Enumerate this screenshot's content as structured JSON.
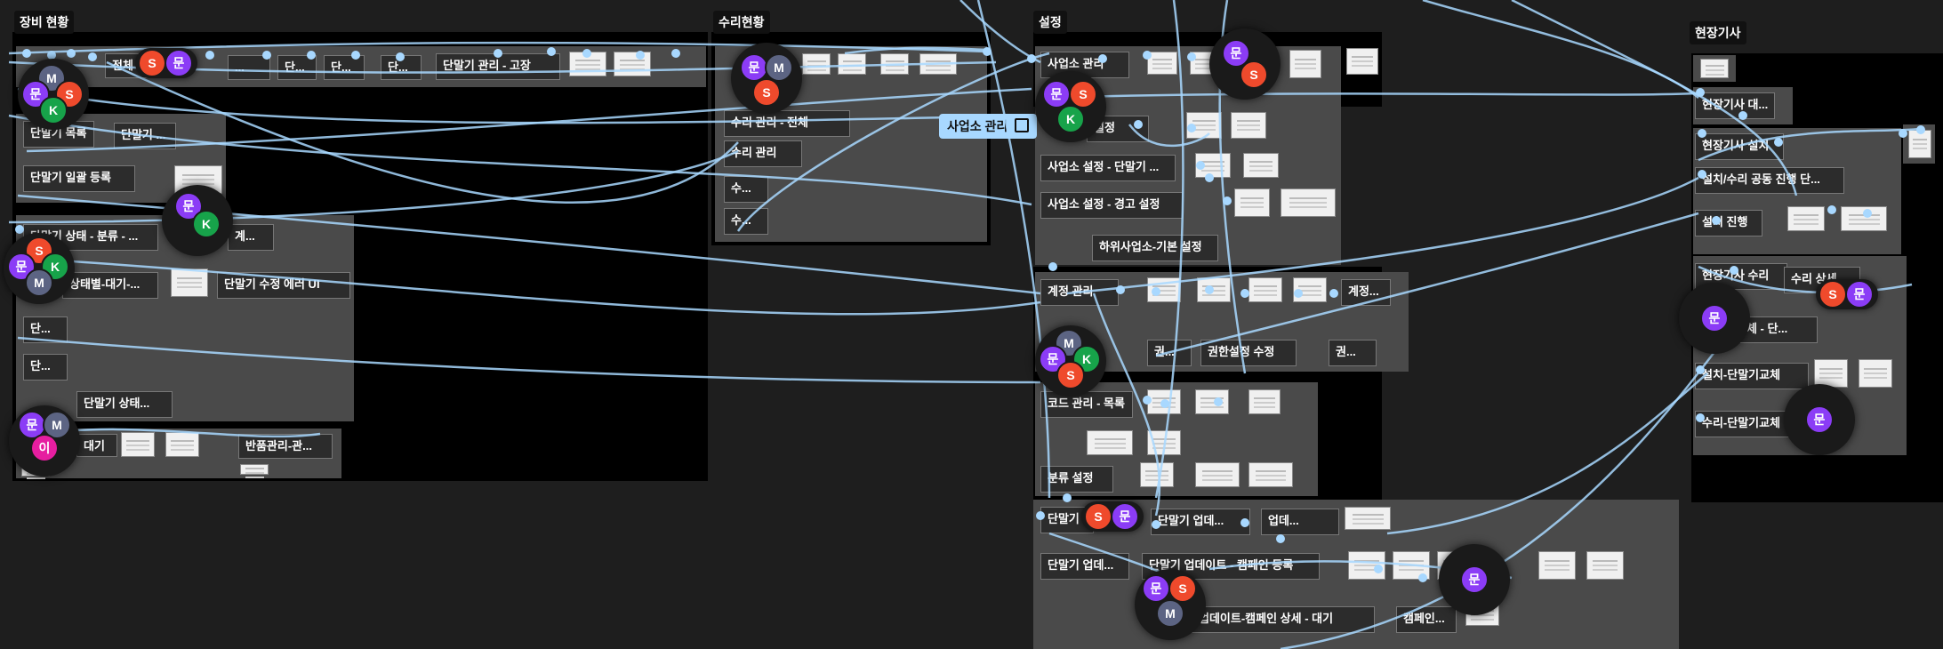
{
  "colors": {
    "canvas_bg": "#1e1e1e",
    "section_bg": "#000000",
    "connector": "#a8d8ff",
    "avatar_orange": "#ef4a2c",
    "avatar_purple": "#8b3cf6",
    "avatar_slate": "#5c6483",
    "avatar_green": "#17a34a",
    "avatar_pink": "#e61ea0"
  },
  "sections": {
    "equipment": {
      "title": "장비 현황"
    },
    "repair": {
      "title": "수리현황"
    },
    "settings": {
      "title": "설정"
    },
    "field": {
      "title": "현장기사"
    }
  },
  "frames": {
    "eq_top_1": "전체",
    "eq_top_2": "...",
    "eq_top_3": "단...",
    "eq_top_4": "단...",
    "eq_top_5": "단...",
    "eq_top_mgmt": "단말기 관리 - 고장",
    "eq_list": "단말기 목록",
    "eq_term": "단말기 ...",
    "eq_bulk": "단말기 일괄 등록",
    "eq_dist": "단말기 상태 - 분류 - ...",
    "eq_ing": "계...",
    "eq_status_wait": "상태별-대기-...",
    "eq_edit_err": "단말기 수정 에러 UI",
    "eq_small_1": "단...",
    "eq_small_2": "단...",
    "eq_status_2": "단말기 상태...",
    "eq_wait": "대기",
    "eq_return": "반품관리-관...",
    "rp_all": "수리 관리 - 전체",
    "rp_mgmt": "수리 관리",
    "rp_s1": "수...",
    "rp_s2": "수...",
    "st_biz": "사업소 관리",
    "st_set": "설정",
    "st_biz_term": "사업소 설정 - 단말기 ...",
    "st_biz_warn": "사업소 설정 - 경고 설정",
    "st_sub_biz": "하위사업소-기본 설정",
    "st_acct": "계정 관리",
    "st_acct2": "계정...",
    "st_perm": "권...",
    "st_perm_edit": "권한설정 수정",
    "st_perm2": "권...",
    "st_code": "코드 관리 - 목록",
    "st_class": "분류 설정",
    "st_term_upd": "단말기",
    "st_upd_a": "단말기 업데...",
    "st_upd_b": "업데...",
    "st_term_upd2": "단말기 업데...",
    "st_campaign_reg": "단말기 업데이트 - 캠페인 등록",
    "st_campaign_wait": "업데이트-캠페인 상세 - 대기",
    "st_campaign": "캠페인...",
    "fd_tech": "현장기사 대...",
    "fd_install": "현장기사 설치",
    "fd_progress": "설치/수리 공동 진행 단...",
    "fd_install_ing": "설치 진행",
    "fd_repair": "현장기사 수리",
    "fd_repair_stat": "수리 상세",
    "fd_replace_a": "교체 - 단...",
    "fd_replace_b": "설치-단말기교체",
    "fd_replace_c": "수리-단말기교체"
  },
  "chips": {
    "biz_mgmt": "사업소 관리"
  },
  "cursors": {
    "eq_top_pill": [
      "S",
      "문"
    ],
    "eq_cluster_1": [
      "M",
      "문",
      "S",
      "K"
    ],
    "eq_cluster_2": [
      "문",
      "K"
    ],
    "eq_cluster_3": [
      "S",
      "문",
      "K",
      "M"
    ],
    "eq_cluster_4": [
      "문",
      "M",
      "이"
    ],
    "repair_cluster": [
      "문",
      "M",
      "S"
    ],
    "settings_cluster_1": [
      "문",
      "S",
      "K"
    ],
    "settings_cluster_2": [
      "문",
      "S"
    ],
    "settings_cluster_3": [
      "M",
      "문",
      "K",
      "S"
    ],
    "settings_pill": [
      "S",
      "문"
    ],
    "settings_cluster_4": [
      "문",
      "S",
      "M"
    ],
    "settings_cluster_5": [
      "문"
    ],
    "field_pill": [
      "S",
      "문"
    ],
    "field_cluster_1": [
      "문"
    ],
    "field_cluster_2": [
      "문"
    ]
  }
}
